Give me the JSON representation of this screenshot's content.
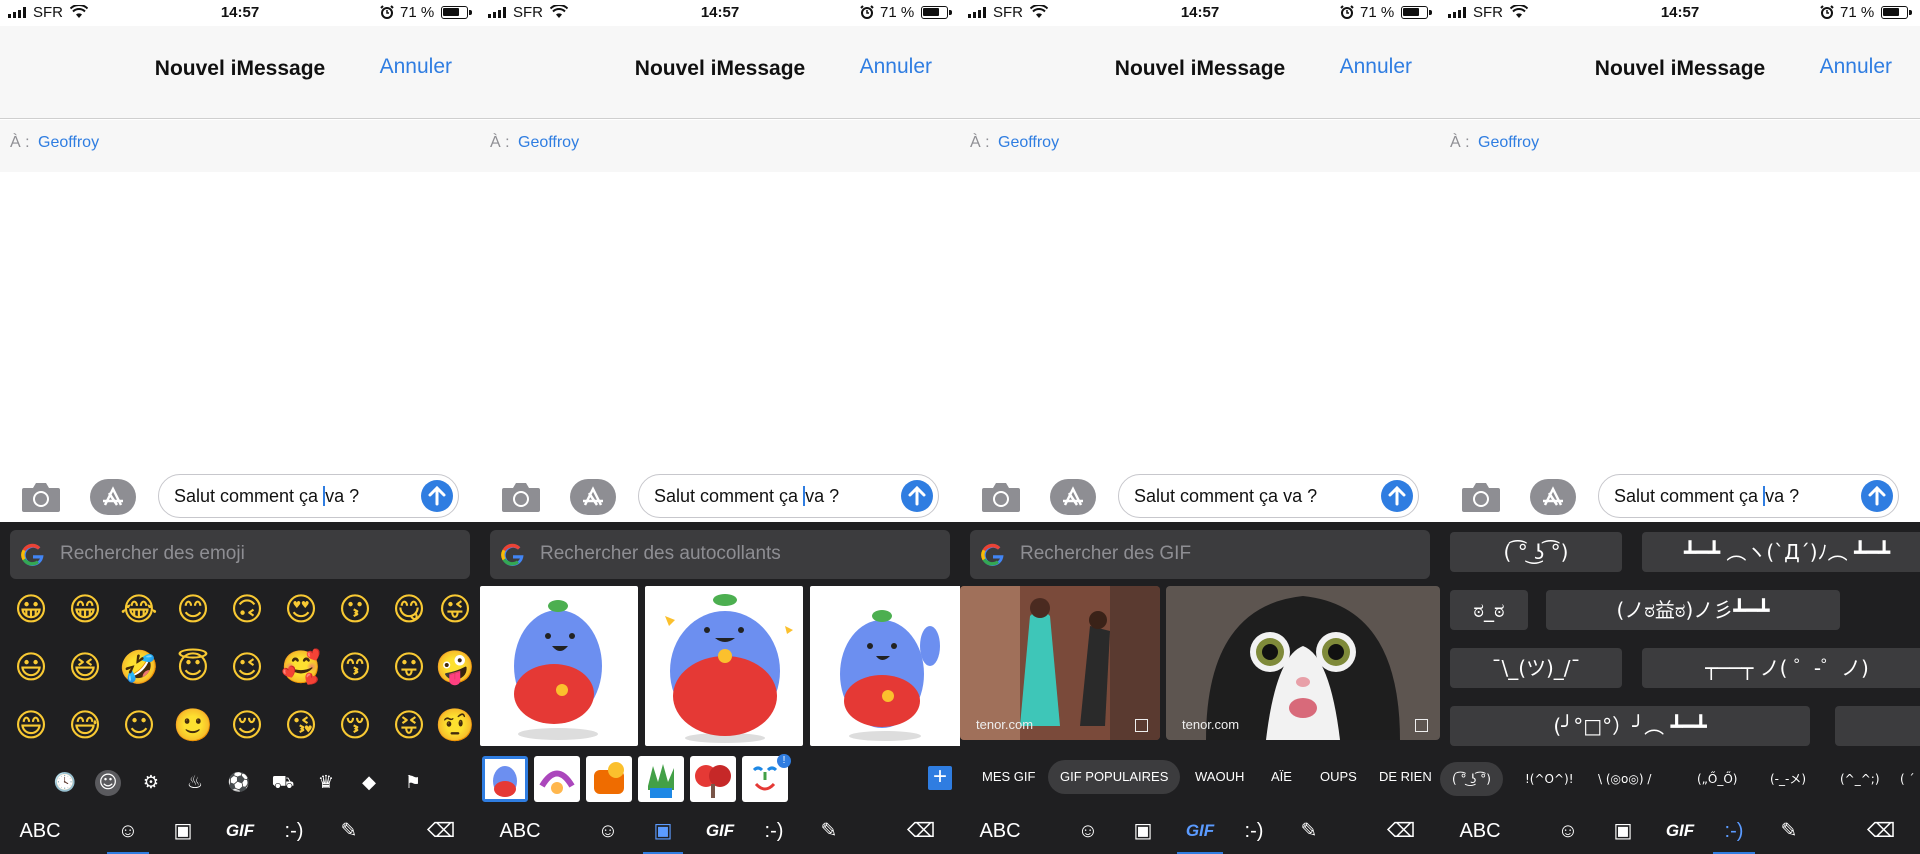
{
  "status": {
    "carrier": "SFR",
    "time": "14:57",
    "battery": "71 %",
    "battery_level": 0.71
  },
  "header": {
    "title": "Nouvel iMessage",
    "cancel_label": "Annuler"
  },
  "recipient": {
    "label": "À :",
    "name": "Geoffroy"
  },
  "composer": {
    "text_before_caret": "Salut comment ça ",
    "text_after_caret": "va ?",
    "text_full": "Salut comment ça va ?"
  },
  "keyboard": {
    "abc_label": "ABC",
    "gif_label": "GIF",
    "kaomoji_label": ":-)",
    "emoji_panel": {
      "placeholder": "Rechercher des emoji",
      "rows": [
        [
          "😀",
          "😁",
          "😂",
          "😊",
          "🙃",
          "😍",
          "😗",
          "😋",
          "😜"
        ],
        [
          "😃",
          "😆",
          "🤣",
          "😇",
          "😉",
          "🥰",
          "😙",
          "😛",
          "🤪"
        ],
        [
          "😄",
          "😅",
          "☺",
          "🙂",
          "😌",
          "😘",
          "😚",
          "😝",
          "🤨"
        ]
      ]
    },
    "sticker_panel": {
      "placeholder": "Rechercher des autocollants"
    },
    "gif_panel": {
      "placeholder": "Rechercher des GIF",
      "credit": "tenor.com",
      "tabs": [
        "MES GIF",
        "GIF POPULAIRES",
        "WAOUH",
        "AÏE",
        "OUPS",
        "DE RIEN"
      ]
    },
    "kaomoji_panel": {
      "items": [
        "( ͡° ͜ʖ ͡°)",
        "┻━┻ ︵ヽ(`Д´)ﾉ︵ ┻━┻",
        "ಠ_ಠ",
        "(ノಠ益ಠ)ノ彡┻━┻",
        "¯\\_(ツ)_/¯",
        "┬──┬ ノ( ゜-゜ノ)",
        "(╯°□°）╯︵ ┻━┻"
      ],
      "tabs": [
        "( ͡° ͜ʖ ͡°)",
        "!(^O^)!",
        "\\ (◎o◎) /",
        "(„Ő_Ő)",
        "(-_-メ)",
        "(^_^;)",
        "( ´"
      ]
    }
  }
}
